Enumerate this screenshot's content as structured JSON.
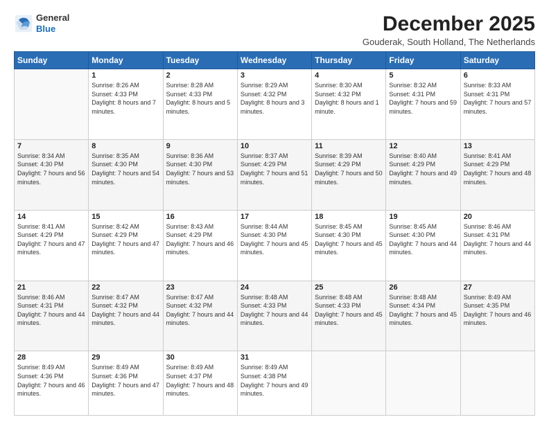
{
  "logo": {
    "line1": "General",
    "line2": "Blue"
  },
  "title": "December 2025",
  "subtitle": "Gouderak, South Holland, The Netherlands",
  "headers": [
    "Sunday",
    "Monday",
    "Tuesday",
    "Wednesday",
    "Thursday",
    "Friday",
    "Saturday"
  ],
  "weeks": [
    [
      {
        "day": "",
        "info": ""
      },
      {
        "day": "1",
        "info": "Sunrise: 8:26 AM\nSunset: 4:33 PM\nDaylight: 8 hours\nand 7 minutes."
      },
      {
        "day": "2",
        "info": "Sunrise: 8:28 AM\nSunset: 4:33 PM\nDaylight: 8 hours\nand 5 minutes."
      },
      {
        "day": "3",
        "info": "Sunrise: 8:29 AM\nSunset: 4:32 PM\nDaylight: 8 hours\nand 3 minutes."
      },
      {
        "day": "4",
        "info": "Sunrise: 8:30 AM\nSunset: 4:32 PM\nDaylight: 8 hours\nand 1 minute."
      },
      {
        "day": "5",
        "info": "Sunrise: 8:32 AM\nSunset: 4:31 PM\nDaylight: 7 hours\nand 59 minutes."
      },
      {
        "day": "6",
        "info": "Sunrise: 8:33 AM\nSunset: 4:31 PM\nDaylight: 7 hours\nand 57 minutes."
      }
    ],
    [
      {
        "day": "7",
        "info": "Sunrise: 8:34 AM\nSunset: 4:30 PM\nDaylight: 7 hours\nand 56 minutes."
      },
      {
        "day": "8",
        "info": "Sunrise: 8:35 AM\nSunset: 4:30 PM\nDaylight: 7 hours\nand 54 minutes."
      },
      {
        "day": "9",
        "info": "Sunrise: 8:36 AM\nSunset: 4:30 PM\nDaylight: 7 hours\nand 53 minutes."
      },
      {
        "day": "10",
        "info": "Sunrise: 8:37 AM\nSunset: 4:29 PM\nDaylight: 7 hours\nand 51 minutes."
      },
      {
        "day": "11",
        "info": "Sunrise: 8:39 AM\nSunset: 4:29 PM\nDaylight: 7 hours\nand 50 minutes."
      },
      {
        "day": "12",
        "info": "Sunrise: 8:40 AM\nSunset: 4:29 PM\nDaylight: 7 hours\nand 49 minutes."
      },
      {
        "day": "13",
        "info": "Sunrise: 8:41 AM\nSunset: 4:29 PM\nDaylight: 7 hours\nand 48 minutes."
      }
    ],
    [
      {
        "day": "14",
        "info": "Sunrise: 8:41 AM\nSunset: 4:29 PM\nDaylight: 7 hours\nand 47 minutes."
      },
      {
        "day": "15",
        "info": "Sunrise: 8:42 AM\nSunset: 4:29 PM\nDaylight: 7 hours\nand 47 minutes."
      },
      {
        "day": "16",
        "info": "Sunrise: 8:43 AM\nSunset: 4:29 PM\nDaylight: 7 hours\nand 46 minutes."
      },
      {
        "day": "17",
        "info": "Sunrise: 8:44 AM\nSunset: 4:30 PM\nDaylight: 7 hours\nand 45 minutes."
      },
      {
        "day": "18",
        "info": "Sunrise: 8:45 AM\nSunset: 4:30 PM\nDaylight: 7 hours\nand 45 minutes."
      },
      {
        "day": "19",
        "info": "Sunrise: 8:45 AM\nSunset: 4:30 PM\nDaylight: 7 hours\nand 44 minutes."
      },
      {
        "day": "20",
        "info": "Sunrise: 8:46 AM\nSunset: 4:31 PM\nDaylight: 7 hours\nand 44 minutes."
      }
    ],
    [
      {
        "day": "21",
        "info": "Sunrise: 8:46 AM\nSunset: 4:31 PM\nDaylight: 7 hours\nand 44 minutes."
      },
      {
        "day": "22",
        "info": "Sunrise: 8:47 AM\nSunset: 4:32 PM\nDaylight: 7 hours\nand 44 minutes."
      },
      {
        "day": "23",
        "info": "Sunrise: 8:47 AM\nSunset: 4:32 PM\nDaylight: 7 hours\nand 44 minutes."
      },
      {
        "day": "24",
        "info": "Sunrise: 8:48 AM\nSunset: 4:33 PM\nDaylight: 7 hours\nand 44 minutes."
      },
      {
        "day": "25",
        "info": "Sunrise: 8:48 AM\nSunset: 4:33 PM\nDaylight: 7 hours\nand 45 minutes."
      },
      {
        "day": "26",
        "info": "Sunrise: 8:48 AM\nSunset: 4:34 PM\nDaylight: 7 hours\nand 45 minutes."
      },
      {
        "day": "27",
        "info": "Sunrise: 8:49 AM\nSunset: 4:35 PM\nDaylight: 7 hours\nand 46 minutes."
      }
    ],
    [
      {
        "day": "28",
        "info": "Sunrise: 8:49 AM\nSunset: 4:36 PM\nDaylight: 7 hours\nand 46 minutes."
      },
      {
        "day": "29",
        "info": "Sunrise: 8:49 AM\nSunset: 4:36 PM\nDaylight: 7 hours\nand 47 minutes."
      },
      {
        "day": "30",
        "info": "Sunrise: 8:49 AM\nSunset: 4:37 PM\nDaylight: 7 hours\nand 48 minutes."
      },
      {
        "day": "31",
        "info": "Sunrise: 8:49 AM\nSunset: 4:38 PM\nDaylight: 7 hours\nand 49 minutes."
      },
      {
        "day": "",
        "info": ""
      },
      {
        "day": "",
        "info": ""
      },
      {
        "day": "",
        "info": ""
      }
    ]
  ]
}
